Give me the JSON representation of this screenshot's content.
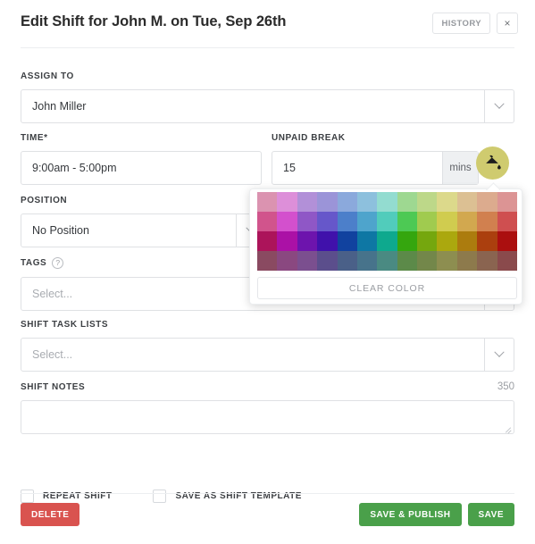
{
  "header": {
    "title": "Edit Shift for John M. on Tue, Sep 26th",
    "history_label": "HISTORY",
    "close_label": "×"
  },
  "form": {
    "assign_to": {
      "label": "ASSIGN TO",
      "value": "John Miller"
    },
    "time": {
      "label": "TIME*",
      "value": "9:00am - 5:00pm"
    },
    "unpaid_break": {
      "label": "UNPAID BREAK",
      "value": "15",
      "suffix": "mins"
    },
    "position": {
      "label": "POSITION",
      "value": "No Position"
    },
    "tags": {
      "label": "TAGS",
      "help": "?",
      "placeholder": "Select..."
    },
    "shift_task_lists": {
      "label": "SHIFT TASK LISTS",
      "placeholder": "Select..."
    },
    "shift_notes": {
      "label": "SHIFT NOTES",
      "char_count": "350",
      "value": ""
    },
    "checkboxes": [
      {
        "label": "REPEAT SHIFT",
        "checked": false
      },
      {
        "label": "SAVE AS SHIFT TEMPLATE",
        "checked": false
      }
    ]
  },
  "footer": {
    "delete_label": "DELETE",
    "save_publish_label": "SAVE & PUBLISH",
    "save_label": "SAVE"
  },
  "color_picker": {
    "trigger_color": "#cfcb6f",
    "trigger_icon": "paint-bucket-icon",
    "clear_label": "CLEAR COLOR",
    "columns": 13,
    "rows": 4,
    "swatches": [
      [
        "#db93b0",
        "#dd8fd9",
        "#b290d8",
        "#9b94d8",
        "#8ba9dc",
        "#8dc0dd",
        "#93dcd0",
        "#9ed891",
        "#bdd889",
        "#dcd98b",
        "#dcc093",
        "#dcab8e",
        "#dc9494"
      ],
      [
        "#d1548c",
        "#d350cd",
        "#8f57c6",
        "#6657ca",
        "#4c7fca",
        "#4ea4cc",
        "#51ccbb",
        "#4dc954",
        "#a0cb4f",
        "#d0cc4f",
        "#d2a84f",
        "#d1804f",
        "#cf4f50"
      ],
      [
        "#ac145a",
        "#ab11a6",
        "#6d14ad",
        "#4011ab",
        "#11429f",
        "#0e77a4",
        "#0ea98e",
        "#35a60e",
        "#75a70e",
        "#aba80e",
        "#ac7c0e",
        "#ab3f0e",
        "#ab0f0f"
      ],
      [
        "#8a4a61",
        "#8a4880",
        "["
      ]
    ]
  }
}
